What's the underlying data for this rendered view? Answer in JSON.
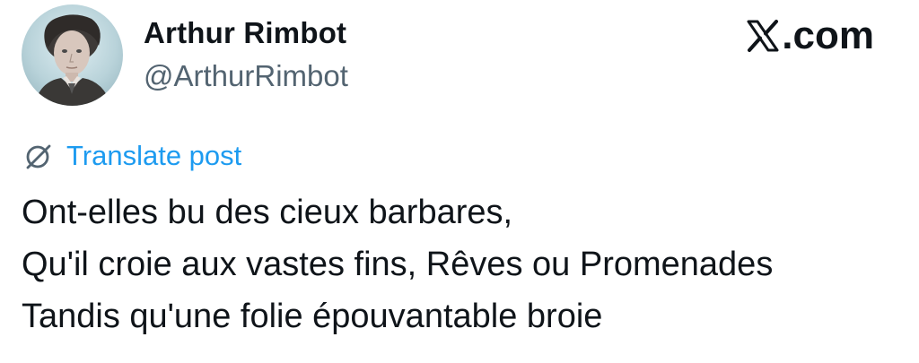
{
  "author": {
    "name": "Arthur Rimbot",
    "handle": "@ArthurRimbot"
  },
  "site": {
    "logo_text": ".com"
  },
  "translate": {
    "label": "Translate post",
    "icon": "translate-globe-icon",
    "color": "#1d9bf0"
  },
  "post": {
    "lines": [
      "Ont-elles bu des cieux barbares,",
      "Qu'il croie aux vastes fins, Rêves ou Promenades",
      "Tandis qu'une folie épouvantable broie"
    ]
  },
  "colors": {
    "text": "#0f1419",
    "handle": "#536471",
    "background": "#ffffff"
  }
}
